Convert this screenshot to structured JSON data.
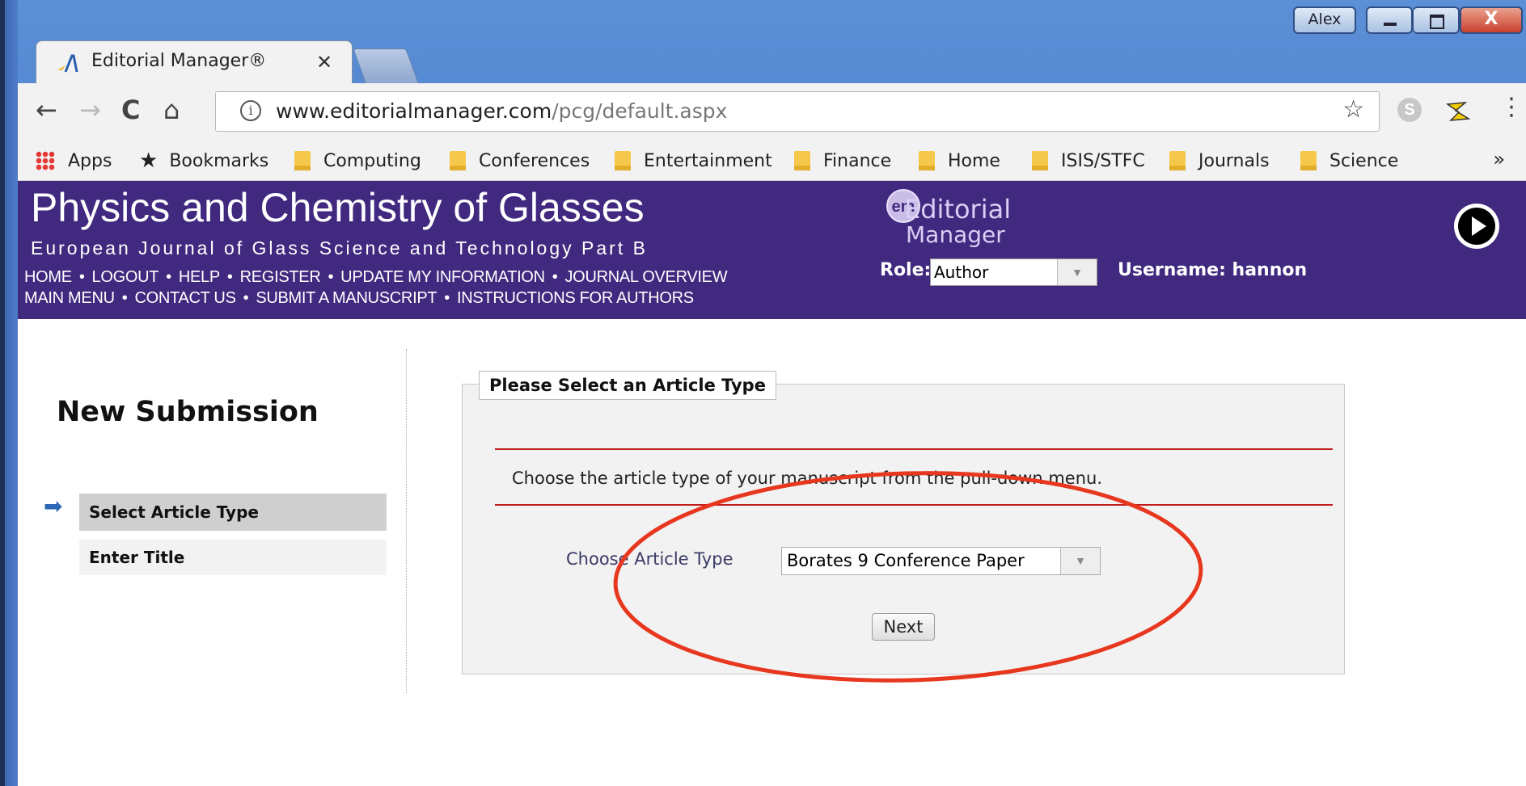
{
  "window": {
    "user_badge": "Alex",
    "min_glyph": "–",
    "max_glyph": "□",
    "close_glyph": "X"
  },
  "tab": {
    "title": "Editorial Manager®",
    "close_glyph": "✕"
  },
  "toolbar": {
    "back_glyph": "←",
    "forward_glyph": "→",
    "reload_glyph": "C",
    "home_glyph": "⌂",
    "info_glyph": "i",
    "url_host": "www.editorialmanager.com",
    "url_path": "/pcg/default.aspx",
    "star_glyph": "☆",
    "skype_glyph": "S",
    "menu_glyph": "⋮"
  },
  "bookmarks": {
    "items": [
      {
        "label": "Apps",
        "icon": "apps-grid-icon"
      },
      {
        "label": "Bookmarks",
        "icon": "star-icon"
      },
      {
        "label": "Computing",
        "icon": "folder-icon"
      },
      {
        "label": "Conferences",
        "icon": "folder-icon"
      },
      {
        "label": "Entertainment",
        "icon": "folder-icon"
      },
      {
        "label": "Finance",
        "icon": "folder-icon"
      },
      {
        "label": "Home",
        "icon": "folder-icon"
      },
      {
        "label": "ISIS/STFC",
        "icon": "folder-icon"
      },
      {
        "label": "Journals",
        "icon": "folder-icon"
      },
      {
        "label": "Science",
        "icon": "folder-icon"
      }
    ],
    "more": "»"
  },
  "journal": {
    "title": "Physics and Chemistry of Glasses",
    "subtitle": "European Journal of Glass Science and Technology Part B",
    "nav_row1": [
      "HOME",
      "LOGOUT",
      "HELP",
      "REGISTER",
      "UPDATE MY INFORMATION",
      "JOURNAL OVERVIEW"
    ],
    "nav_row2": [
      "MAIN MENU",
      "CONTACT US",
      "SUBMIT A MANUSCRIPT",
      "INSTRUCTIONS FOR AUTHORS"
    ],
    "separator": "•",
    "logo": {
      "badge": "em",
      "line1": "Editorial",
      "line2": "Manager"
    },
    "role_label": "Role:",
    "role_value": "Author",
    "username": "Username: hannon"
  },
  "sidebar": {
    "title": "New Submission",
    "arrow_glyph": "➡",
    "steps": [
      {
        "label": "Select Article Type",
        "active": true
      },
      {
        "label": "Enter Title",
        "active": false
      }
    ]
  },
  "form": {
    "legend": "Please Select an Article Type",
    "instructions": "Choose the article type of your manuscript from the pull-down menu.",
    "choose_label": "Choose Article Type",
    "article_type_value": "Borates 9 Conference Paper",
    "next_label": "Next"
  },
  "colors": {
    "header_purple": "#40297f",
    "annotation_red": "#e8371f",
    "divider_red": "#c21b1b"
  }
}
